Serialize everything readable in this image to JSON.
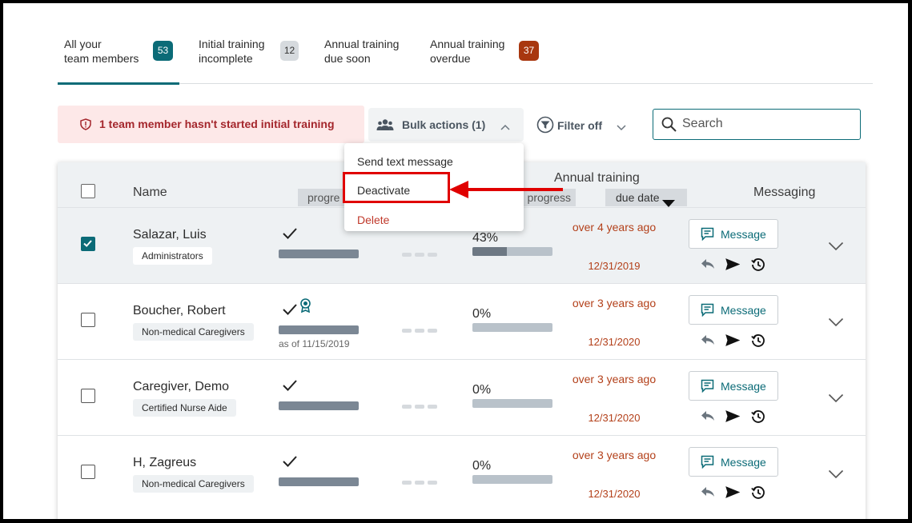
{
  "tabs": [
    {
      "line1": "All your",
      "line2": "team members",
      "count": "53",
      "badge_color": "#0b6b77"
    },
    {
      "line1": "Initial training",
      "line2": "incomplete",
      "count": "12",
      "badge_color": "#d6dade"
    },
    {
      "line1": "Annual training",
      "line2": "due soon",
      "count": "",
      "badge_color": ""
    },
    {
      "line1": "Annual training",
      "line2": "overdue",
      "count": "37",
      "badge_color": "#a8370f"
    }
  ],
  "alert": {
    "text": "1 team member hasn't started initial training",
    "icon": "shield-alert-icon"
  },
  "bulk": {
    "label": "Bulk actions (1)",
    "icon": "people-icon"
  },
  "filter": {
    "label": "Filter off",
    "icon": "filter-icon"
  },
  "search": {
    "placeholder": "Search"
  },
  "menu": {
    "items": [
      "Send text message",
      "Deactivate",
      "Delete"
    ]
  },
  "table": {
    "headers": {
      "name": "Name",
      "initial_progress": "progre",
      "annual": "Annual training",
      "annual_progress": "progress",
      "due_date": "due date",
      "messaging": "Messaging"
    },
    "rows": [
      {
        "name": "Salazar, Luis",
        "role": "Administrators",
        "selected": true,
        "initial_done": true,
        "certified": false,
        "as_of": "",
        "annual_pct_label": "43%",
        "annual_pct": 0.43,
        "due_relative": "over 4 years ago",
        "due_date": "12/31/2019",
        "message_label": "Message"
      },
      {
        "name": "Boucher, Robert",
        "role": "Non-medical Caregivers",
        "selected": false,
        "initial_done": true,
        "certified": true,
        "as_of": "as of 11/15/2019",
        "annual_pct_label": "0%",
        "annual_pct": 0,
        "due_relative": "over 3 years ago",
        "due_date": "12/31/2020",
        "message_label": "Message"
      },
      {
        "name": "Caregiver, Demo",
        "role": "Certified Nurse Aide",
        "selected": false,
        "initial_done": true,
        "certified": false,
        "as_of": "",
        "annual_pct_label": "0%",
        "annual_pct": 0,
        "due_relative": "over 3 years ago",
        "due_date": "12/31/2020",
        "message_label": "Message"
      },
      {
        "name": "H, Zagreus",
        "role": "Non-medical Caregivers",
        "selected": false,
        "initial_done": true,
        "certified": false,
        "as_of": "",
        "annual_pct_label": "0%",
        "annual_pct": 0,
        "due_relative": "over 3 years ago",
        "due_date": "12/31/2020",
        "message_label": "Message"
      }
    ]
  },
  "colors": {
    "accent": "#0b6b77",
    "overdue": "#b3401a",
    "highlight": "#e00000"
  }
}
